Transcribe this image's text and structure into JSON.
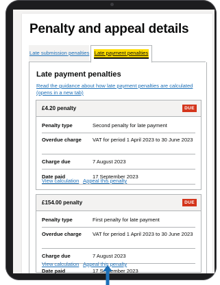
{
  "page": {
    "title": "Penalty and appeal details"
  },
  "tabs": [
    {
      "label": "Late submission penalties",
      "selected": false
    },
    {
      "label": "Late payment penalties",
      "selected": true
    }
  ],
  "panel": {
    "heading": "Late payment penalties",
    "guidance_link": "Read the guidance about how late payment penalties are calculated (opens in a new tab)"
  },
  "penalties": [
    {
      "amount": "£4.20 penalty",
      "status": "DUE",
      "rows": [
        {
          "key": "Penalty type",
          "value": "Second penalty for late payment"
        },
        {
          "key": "Overdue charge",
          "value": "VAT for period 1 April 2023 to 30 June 2023"
        },
        {
          "key": "Charge due",
          "value": "7 August 2023"
        },
        {
          "key": "Date paid",
          "value": "17 September 2023"
        }
      ],
      "links": [
        "View calculation",
        "Appeal this penalty"
      ]
    },
    {
      "amount": "£154.00 penalty",
      "status": "DUE",
      "rows": [
        {
          "key": "Penalty type",
          "value": "First penalty for late payment"
        },
        {
          "key": "Overdue charge",
          "value": "VAT for period 1 April 2023 to 30 June 2023"
        },
        {
          "key": "Charge due",
          "value": "7 August 2023"
        },
        {
          "key": "Date paid",
          "value": "17 September 2023"
        }
      ],
      "links": [
        "View calculation",
        "Appeal this penalty"
      ]
    }
  ],
  "colors": {
    "link": "#1d70b8",
    "text": "#0b0c0c",
    "due_tag": "#d4351c",
    "focus": "#ffdd00",
    "border": "#b1b4b6",
    "card_header": "#f3f2f1",
    "tablet_frame": "#1d1d1f",
    "arrow": "#1d70b8"
  },
  "icons": {
    "pointer": "up-arrow-icon"
  }
}
